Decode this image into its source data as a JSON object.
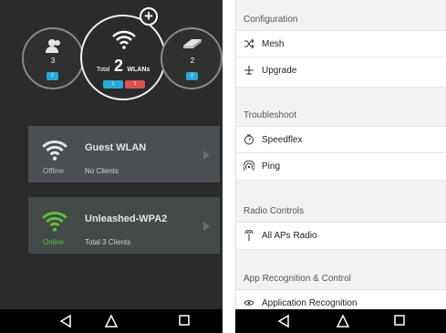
{
  "summary": {
    "left_count": "3",
    "left_badge": "2",
    "center_total_prefix": "Total",
    "center_total_value": "2",
    "center_total_suffix": "WLANs",
    "center_badge_blue": "1",
    "center_badge_red": "1",
    "right_count": "2",
    "right_badge": "2"
  },
  "wlans": [
    {
      "name": "Guest WLAN",
      "status": "Offline",
      "clients": "No Clients",
      "status_color": "#b8b8b8",
      "icon_color": "#e6e6e6"
    },
    {
      "name": "Unleashed-WPA2",
      "status": "Online",
      "clients": "Total 3 Clients",
      "status_color": "#5fbf3f",
      "icon_color": "#5fbf3f"
    }
  ],
  "settings": {
    "sections": [
      {
        "title": "Configuration",
        "items": [
          {
            "label": "Mesh",
            "icon": "shuffle-icon"
          },
          {
            "label": "Upgrade",
            "icon": "airplane-icon"
          }
        ]
      },
      {
        "title": "Troubleshoot",
        "items": [
          {
            "label": "Speedflex",
            "icon": "timer-icon"
          },
          {
            "label": "Ping",
            "icon": "signal-icon"
          }
        ]
      },
      {
        "title": "Radio Controls",
        "items": [
          {
            "label": "All APs Radio",
            "icon": "antenna-icon"
          }
        ]
      },
      {
        "title": "App Recognition & Control",
        "items": [
          {
            "label": "Application Recognition",
            "icon": "eye-icon"
          }
        ]
      }
    ]
  },
  "colors": {
    "badge_blue": "#2aa8d8",
    "badge_red": "#d9534f",
    "panel_dark": "#2b2b2b"
  }
}
